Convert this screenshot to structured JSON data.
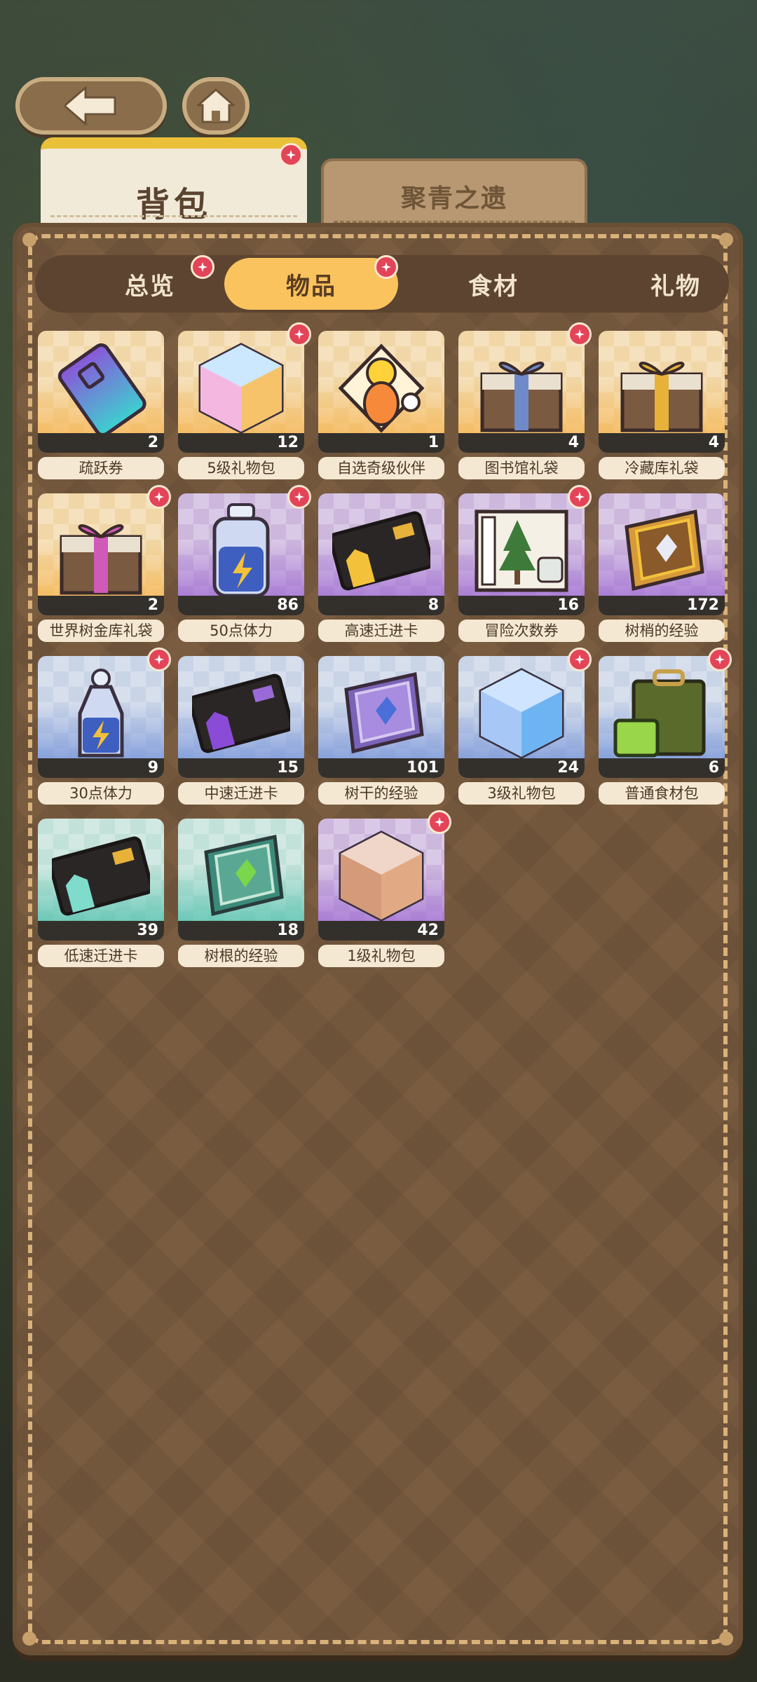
{
  "tabs": {
    "main": "背包",
    "secondary": "聚青之遗"
  },
  "categories": [
    {
      "label": "总览",
      "active": false,
      "badge": true
    },
    {
      "label": "物品",
      "active": true,
      "badge": true
    },
    {
      "label": "食材",
      "active": false,
      "badge": false
    },
    {
      "label": "礼物",
      "active": false,
      "badge": false
    }
  ],
  "items": [
    {
      "name": "疏跃券",
      "count": "2",
      "icon": "ticket-icon",
      "badge": false,
      "theme": "gold"
    },
    {
      "name": "5级礼物包",
      "count": "12",
      "icon": "rainbow-cube-icon",
      "badge": true,
      "theme": "gold"
    },
    {
      "name": "自选奇级伙伴",
      "count": "1",
      "icon": "companion-selector-icon",
      "badge": false,
      "theme": "gold"
    },
    {
      "name": "图书馆礼袋",
      "count": "4",
      "icon": "blue-gift-box-icon",
      "badge": true,
      "theme": "gold"
    },
    {
      "name": "冷藏库礼袋",
      "count": "4",
      "icon": "gold-gift-box-icon",
      "badge": false,
      "theme": "gold"
    },
    {
      "name": "世界树金库礼袋",
      "count": "2",
      "icon": "pink-gift-box-icon",
      "badge": true,
      "theme": "gold"
    },
    {
      "name": "50点体力",
      "count": "86",
      "icon": "energy-bottle-icon",
      "badge": true,
      "theme": "purple"
    },
    {
      "name": "高速迁进卡",
      "count": "8",
      "icon": "gold-card-icon",
      "badge": false,
      "theme": "purple"
    },
    {
      "name": "冒险次数券",
      "count": "16",
      "icon": "adventure-ticket-icon",
      "badge": true,
      "theme": "purple"
    },
    {
      "name": "树梢的经验",
      "count": "172",
      "icon": "gold-book-icon",
      "badge": false,
      "theme": "purple"
    },
    {
      "name": "30点体力",
      "count": "9",
      "icon": "small-energy-bottle-icon",
      "badge": true,
      "theme": "blue"
    },
    {
      "name": "中速迁进卡",
      "count": "15",
      "icon": "purple-card-icon",
      "badge": false,
      "theme": "blue"
    },
    {
      "name": "树干的经验",
      "count": "101",
      "icon": "purple-book-icon",
      "badge": false,
      "theme": "blue"
    },
    {
      "name": "3级礼物包",
      "count": "24",
      "icon": "blue-cube-icon",
      "badge": true,
      "theme": "blue"
    },
    {
      "name": "普通食材包",
      "count": "6",
      "icon": "ingredient-bag-icon",
      "badge": true,
      "theme": "blue"
    },
    {
      "name": "低速迁进卡",
      "count": "39",
      "icon": "teal-card-icon",
      "badge": false,
      "theme": "teal"
    },
    {
      "name": "树根的经验",
      "count": "18",
      "icon": "green-book-icon",
      "badge": false,
      "theme": "teal"
    },
    {
      "name": "1级礼物包",
      "count": "42",
      "icon": "pink-cube-icon",
      "badge": true,
      "theme": "purple"
    }
  ]
}
